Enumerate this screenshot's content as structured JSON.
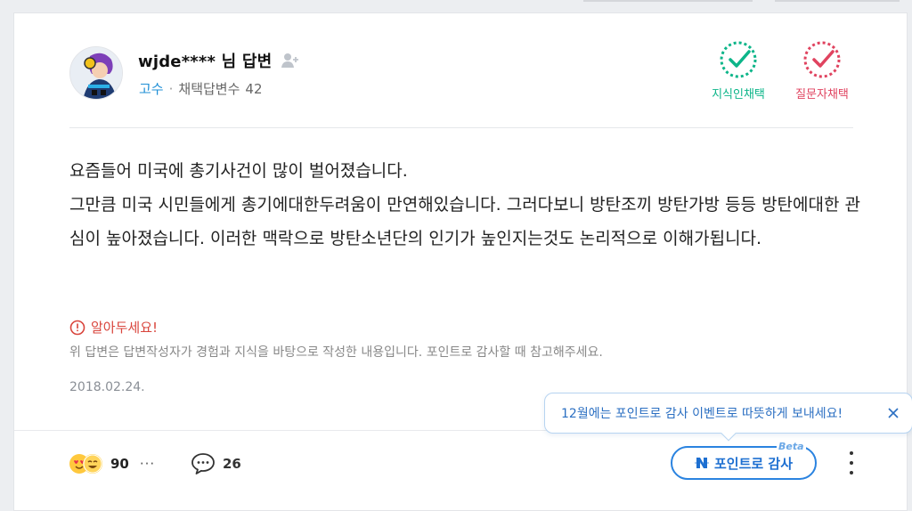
{
  "answer": {
    "author": "wjde**** 님 답변",
    "grade": "고수",
    "separator": "·",
    "adopted_label": "채택답변수",
    "adopted_count": "42",
    "badges": [
      {
        "label": "지식인채택",
        "color": "#0cb589"
      },
      {
        "label": "질문자채택",
        "color": "#e0435f"
      }
    ],
    "body": [
      "요즘들어 미국에 총기사건이 많이 벌어졌습니다.",
      "그만큼 미국 시민들에게 총기에대한두려움이 만연해있습니다. 그러다보니 방탄조끼 방탄가방 등등 방탄에대한 관심이 높아졌습니다. 이러한 맥락으로 방탄소년단의 인기가 높인지는것도 논리적으로 이해가됩니다."
    ],
    "notice_title": "알아두세요!",
    "notice_body": "위 답변은 답변작성자가 경험과 지식을 바탕으로 작성한 내용입니다. 포인트로 감사할 때 참고해주세요.",
    "date": "2018.02.24."
  },
  "footer": {
    "reaction_count": "90",
    "more": "···",
    "comment_count": "26",
    "point_button_label": "포인트로 감사",
    "beta": "Beta"
  },
  "tooltip": {
    "text": "12월에는 포인트로 감사 이벤트로 따뜻하게 보내세요!"
  },
  "colors": {
    "accent_blue": "#2a83e0",
    "green": "#0cb589",
    "red": "#e0435f"
  },
  "icons": [
    "add-friend-icon",
    "check-badge-icon",
    "alert-circle-icon",
    "speech-bubble-icon",
    "naver-n-icon",
    "kebab-menu-icon",
    "close-icon"
  ]
}
